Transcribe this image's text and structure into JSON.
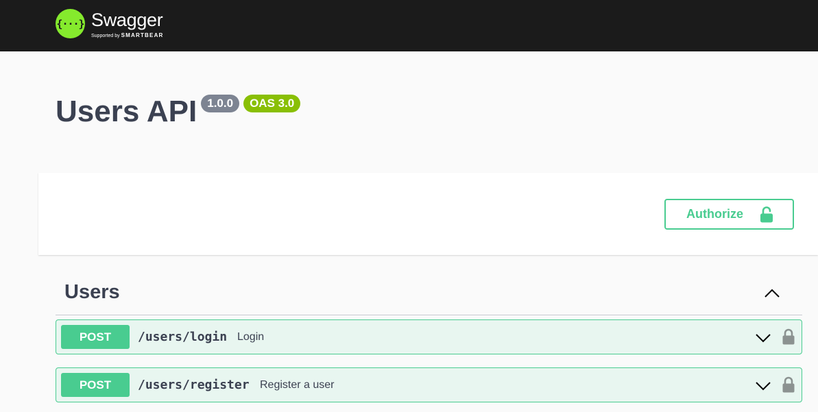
{
  "header": {
    "logo_icon_text": "{···}",
    "logo_name": "Swagger",
    "logo_sub_prefix": "Supported by",
    "logo_sub_brand": "SMARTBEAR"
  },
  "info": {
    "title": "Users API",
    "version": "1.0.0",
    "oas": "OAS 3.0"
  },
  "scheme": {
    "authorize_label": "Authorize",
    "authorize_icon": "unlock-icon"
  },
  "tag": {
    "name": "Users",
    "toggle_icon": "chevron-up-icon"
  },
  "operations": [
    {
      "method": "POST",
      "path": "/users/login",
      "summary": "Login",
      "expand_icon": "chevron-down-icon",
      "lock_icon": "lock-icon"
    },
    {
      "method": "POST",
      "path": "/users/register",
      "summary": "Register a user",
      "expand_icon": "chevron-down-icon",
      "lock_icon": "lock-icon"
    }
  ],
  "colors": {
    "topbar": "#1b1b1b",
    "logo_green": "#85ea2d",
    "post": "#49cc90",
    "post_bg": "#e8f6f0",
    "version_badge": "#7d8492",
    "oas_badge": "#89bf04",
    "text": "#3b4151"
  }
}
